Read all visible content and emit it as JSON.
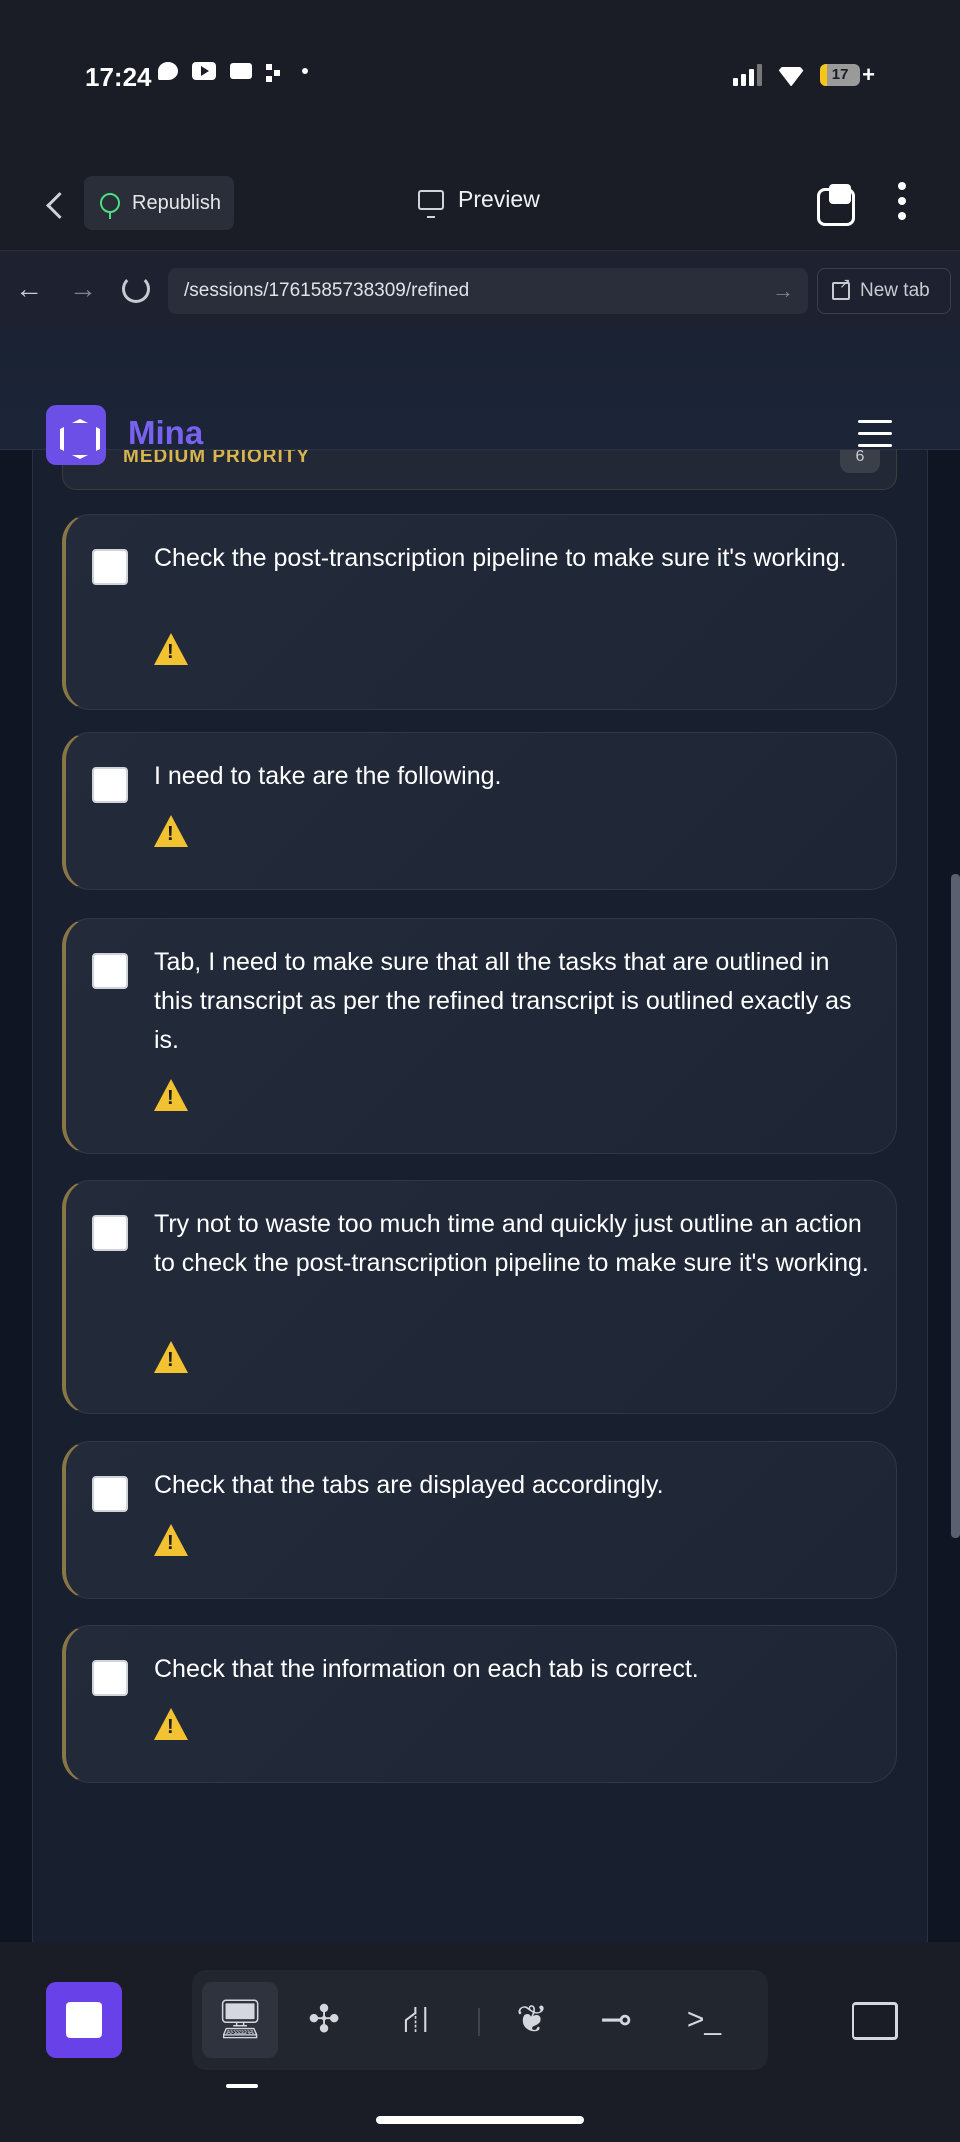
{
  "status_bar": {
    "time": "17:24",
    "battery_level": "17",
    "battery_fraction": 0.17,
    "icons": [
      "chat-bubble-icon",
      "youtube-icon",
      "mail-icon",
      "dots-icon",
      "notification-dot-icon",
      "signal-icon",
      "wifi-icon",
      "battery-icon"
    ]
  },
  "header": {
    "republish_label": "Republish",
    "title": "Preview"
  },
  "browser": {
    "url": "/sessions/1761585738309/refined",
    "new_tab_label": "New tab",
    "go_icon": "→",
    "back_icon": "←",
    "forward_icon": "→"
  },
  "site": {
    "logo_text": "Mina"
  },
  "priority_group": {
    "label": "MEDIUM PRIORITY",
    "count": "6",
    "accent_color": "#d9b64d"
  },
  "tasks": [
    {
      "text": "Check the post-transcription pipeline to make sure it's working."
    },
    {
      "text": "I need to take are the following."
    },
    {
      "text": "Tab, I need to make sure that all the tasks that are outlined in this transcript as per the refined transcript is outlined exactly as is."
    },
    {
      "text": "Try not to waste too much time and quickly just outline an action to check the post-transcription pipeline to make sure it's working."
    },
    {
      "text": "Check that the tabs are displayed accordingly."
    },
    {
      "text": "Check that the information on each tab is correct."
    }
  ],
  "toolbar": {
    "tools": [
      {
        "name": "preview-tool",
        "glyph": "🖥",
        "active": true
      },
      {
        "name": "agents-tool",
        "glyph": "✣",
        "active": false
      },
      {
        "name": "deploy-tool",
        "glyph": "⛙",
        "active": false
      },
      {
        "name": "shell-tool",
        "glyph": "❦",
        "active": false
      },
      {
        "name": "git-tool",
        "glyph": "⊸",
        "active": false
      },
      {
        "name": "console-tool",
        "glyph": ">_",
        "active": false
      }
    ]
  },
  "colors": {
    "brand": "#6c4fe6",
    "background": "#0f1523",
    "card": "#232b3b",
    "warning": "#f2c230"
  }
}
